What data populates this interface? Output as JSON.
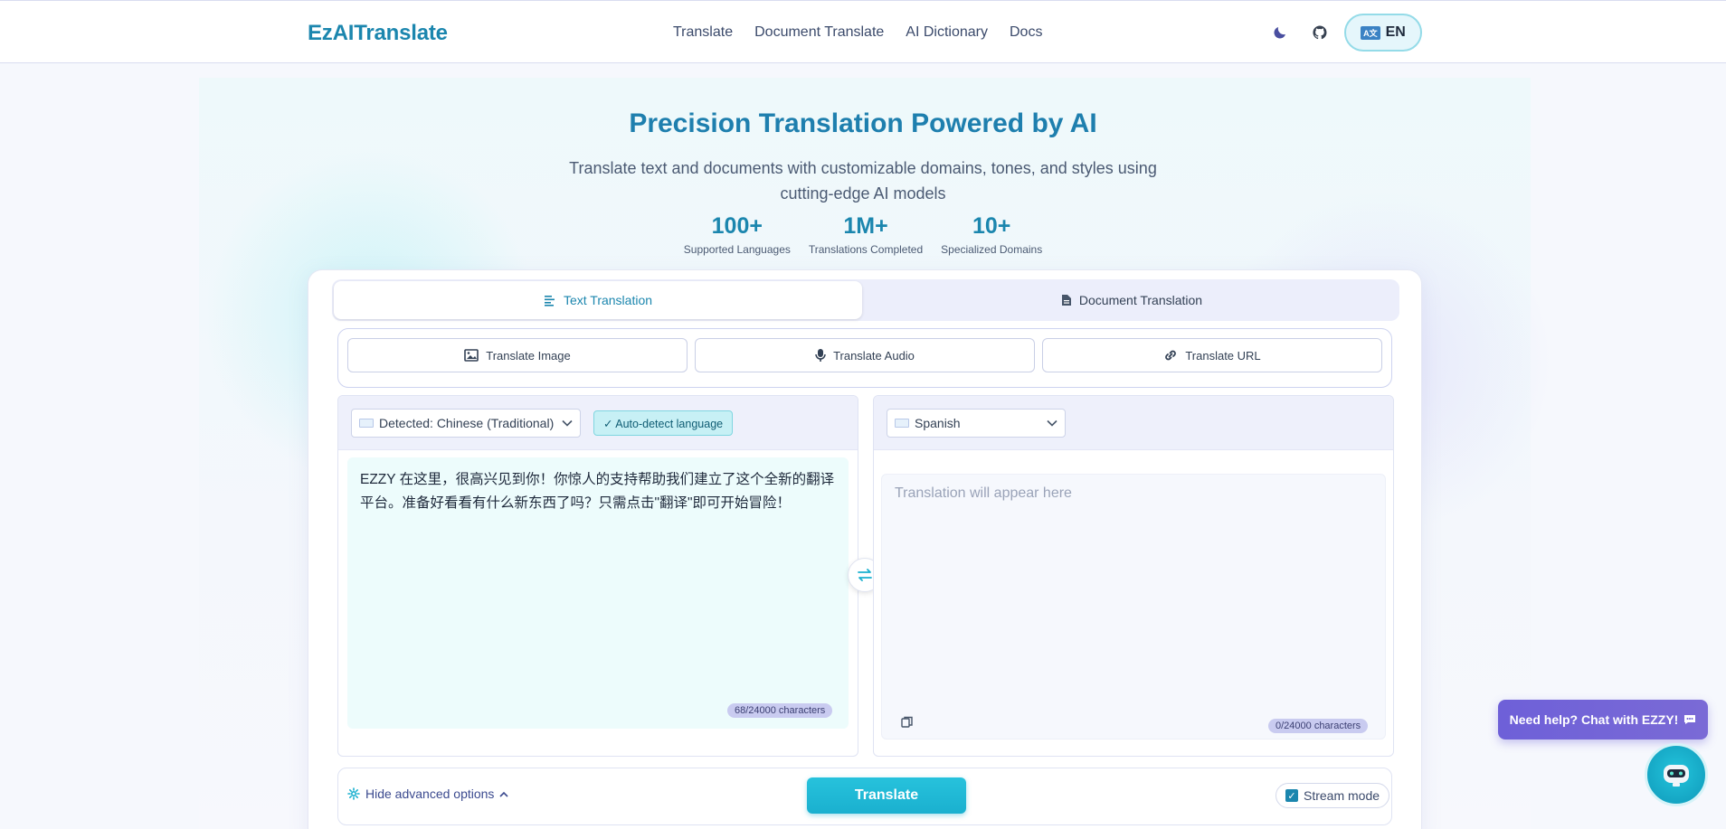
{
  "header": {
    "logo": "EzAITranslate",
    "nav": [
      "Translate",
      "Document Translate",
      "AI Dictionary",
      "Docs"
    ],
    "lang_button": "EN"
  },
  "hero": {
    "title": "Precision Translation Powered by AI",
    "subtitle": "Translate text and documents with customizable domains, tones, and styles using cutting-edge AI models",
    "stats": [
      {
        "value": "100+",
        "label": "Supported Languages"
      },
      {
        "value": "1M+",
        "label": "Translations Completed"
      },
      {
        "value": "10+",
        "label": "Specialized Domains"
      }
    ]
  },
  "tabs": {
    "text": "Text Translation",
    "document": "Document Translation"
  },
  "tools": {
    "image": "Translate Image",
    "audio": "Translate Audio",
    "url": "Translate URL"
  },
  "source": {
    "language": "Detected: Chinese (Traditional)",
    "auto_detect": "✓ Auto-detect language",
    "text": "EZZY 在这里，很高兴见到你！你惊人的支持帮助我们建立了这个全新的翻译平台。准备好看看有什么新东西了吗？只需点击\"翻译\"即可开始冒险！",
    "char_count": "68/24000 characters"
  },
  "target": {
    "language": "Spanish",
    "placeholder": "Translation will appear here",
    "char_count": "0/24000 characters"
  },
  "bottom": {
    "advanced": "Hide advanced options",
    "translate": "Translate",
    "stream_mode": "Stream mode"
  },
  "chat": {
    "bubble": "Need help? Chat with EZZY!"
  },
  "colors": {
    "brand": "#1b86ae",
    "accent": "#1ab0cf",
    "chat": "#6e60d8"
  }
}
